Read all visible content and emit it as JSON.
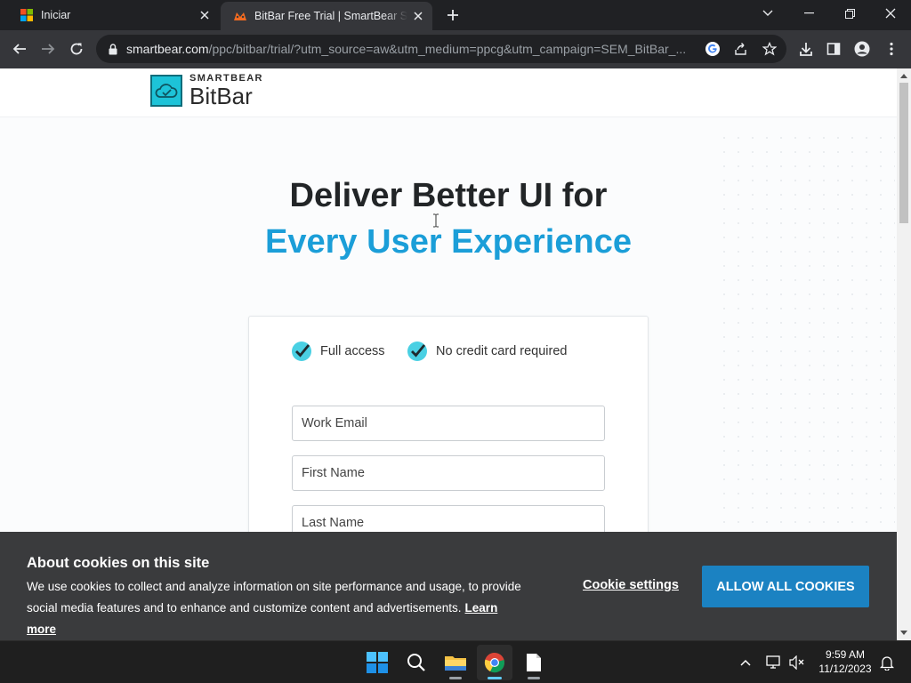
{
  "tabs": [
    {
      "title": "Iniciar"
    },
    {
      "title": "BitBar Free Trial | SmartBear Software"
    }
  ],
  "address": {
    "host": "smartbear.com",
    "path": "/ppc/bitbar/trial/?utm_source=aw&utm_medium=ppcg&utm_campaign=SEM_BitBar_..."
  },
  "site": {
    "brand": "SMARTBEAR",
    "product": "BitBar"
  },
  "hero": {
    "line1": "Deliver Better UI for",
    "line2": "Every User Experience"
  },
  "form": {
    "perks": [
      "Full access",
      "No credit card required"
    ],
    "fields": {
      "email_placeholder": "Work Email",
      "first_name_placeholder": "First Name",
      "last_name_placeholder": "Last Name"
    }
  },
  "cookie_banner": {
    "title": "About cookies on this site",
    "text": "We use cookies to collect and analyze information on site performance and usage, to provide social media features and to enhance and customize content and advertisements.",
    "learn_more": "Learn more",
    "settings_label": "Cookie settings",
    "allow_label": "ALLOW ALL COOKIES"
  },
  "taskbar": {
    "time": "9:59 AM",
    "date": "11/12/2023"
  },
  "colors": {
    "accent": "#1b9ed8",
    "cookie_button": "#1b82c2",
    "check": "#4ad0e3"
  }
}
